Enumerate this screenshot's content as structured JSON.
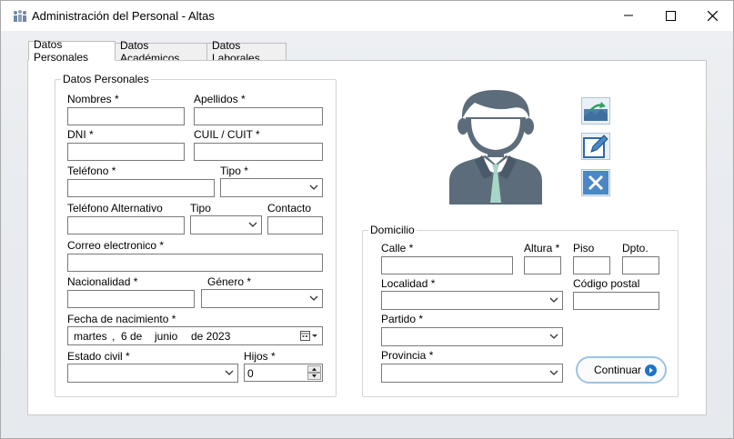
{
  "window": {
    "title": "Administración del Personal - Altas",
    "controls": [
      "minimize-icon",
      "maximize-icon",
      "close-icon"
    ]
  },
  "tabs": [
    {
      "label": "Datos Personales",
      "active": true
    },
    {
      "label": "Datos Académicos",
      "active": false
    },
    {
      "label": "Datos Laborales",
      "active": false
    }
  ],
  "personal": {
    "legend": "Datos Personales",
    "nombres_label": "Nombres *",
    "apellidos_label": "Apellidos *",
    "dni_label": "DNI *",
    "cuil_label": "CUIL / CUIT *",
    "telefono_label": "Teléfono *",
    "tipo_label": "Tipo *",
    "telefono_alt_label": "Teléfono Alternativo",
    "tipo_alt_label": "Tipo",
    "contacto_label": "Contacto",
    "correo_label": "Correo electronico *",
    "nacionalidad_label": "Nacionalidad *",
    "genero_label": "Género *",
    "fecha_label": "Fecha de nacimiento *",
    "fecha_value": {
      "weekday": "martes",
      "sep": ",",
      "day": "6 de",
      "month": "junio",
      "year": "de 2023"
    },
    "estado_civil_label": "Estado civil *",
    "hijos_label": "Hijos *",
    "hijos_value": "0"
  },
  "photo_actions": {
    "icons": [
      "upload-photo-icon",
      "edit-photo-icon",
      "delete-photo-icon"
    ],
    "accent": "#4a87c5"
  },
  "domicilio": {
    "legend": "Domicilio",
    "calle_label": "Calle *",
    "altura_label": "Altura *",
    "piso_label": "Piso",
    "dpto_label": "Dpto.",
    "localidad_label": "Localidad *",
    "codigo_postal_label": "Código postal",
    "partido_label": "Partido *",
    "provincia_label": "Provincia *"
  },
  "actions": {
    "continuar_label": "Continuar",
    "continuar_icon": "arrow-right-circle-icon",
    "accent": "#1e74c6"
  }
}
